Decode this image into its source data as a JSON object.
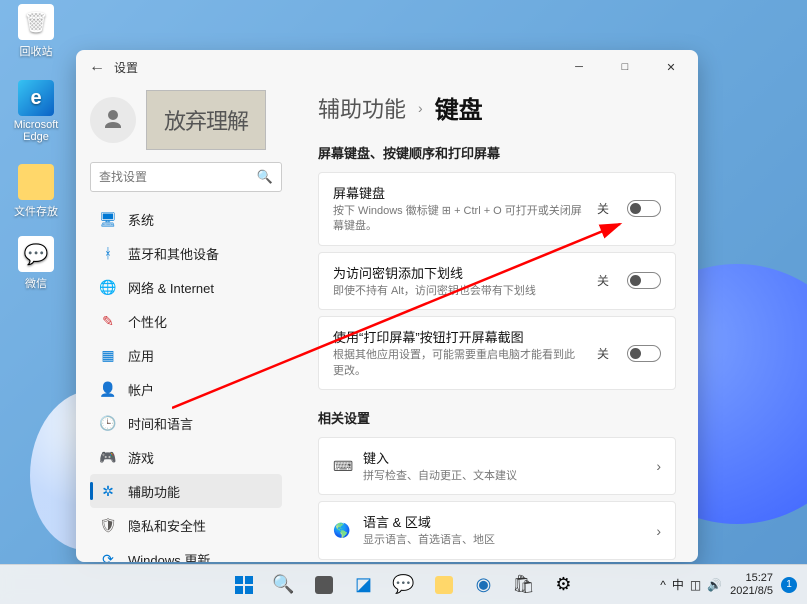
{
  "desktop": {
    "icons": [
      {
        "label": "回收站",
        "glyph_bg": "#ffffff",
        "glyph": "🗑"
      },
      {
        "label": "Microsoft Edge",
        "glyph_bg": "#1b6fb8",
        "glyph": "e"
      },
      {
        "label": "文件存放",
        "glyph_bg": "#ffd76a",
        "glyph": ""
      },
      {
        "label": "微信",
        "glyph_bg": "#1aad19",
        "glyph": "💬"
      }
    ]
  },
  "window": {
    "back": "←",
    "title": "设置",
    "user_caption": "放弃理解",
    "search_placeholder": "查找设置",
    "nav": [
      {
        "icon": "🖥",
        "color": "#0078d4",
        "label": "系统"
      },
      {
        "icon": "ᚼ",
        "color": "#0078d4",
        "label": "蓝牙和其他设备"
      },
      {
        "icon": "🌐",
        "color": "#107c10",
        "label": "网络 & Internet"
      },
      {
        "icon": "✎",
        "color": "#d13438",
        "label": "个性化"
      },
      {
        "icon": "▦",
        "color": "#0078d4",
        "label": "应用"
      },
      {
        "icon": "👤",
        "color": "#8661c5",
        "label": "帐户"
      },
      {
        "icon": "🕒",
        "color": "#c19c00",
        "label": "时间和语言"
      },
      {
        "icon": "🎮",
        "color": "#107c10",
        "label": "游戏"
      },
      {
        "icon": "✲",
        "color": "#0078d4",
        "label": "辅助功能",
        "active": true
      },
      {
        "icon": "🛡",
        "color": "#5d5a58",
        "label": "隐私和安全性"
      },
      {
        "icon": "⟳",
        "color": "#0078d4",
        "label": "Windows 更新"
      }
    ],
    "breadcrumb": {
      "parent": "辅助功能",
      "sep": "›",
      "current": "键盘"
    },
    "section1": "屏幕键盘、按键顺序和打印屏幕",
    "toggles": [
      {
        "title": "屏幕键盘",
        "desc": "按下 Windows 徽标键 ⊞ + Ctrl + O 可打开或关闭屏幕键盘。",
        "state": "关"
      },
      {
        "title": "为访问密钥添加下划线",
        "desc": "即使不持有 Alt，访问密钥也会带有下划线",
        "state": "关"
      },
      {
        "title": "使用“打印屏幕”按钮打开屏幕截图",
        "desc": "根据其他应用设置，可能需要重启电脑才能看到此更改。",
        "state": "关"
      }
    ],
    "section2": "相关设置",
    "links": [
      {
        "icon": "⌨",
        "title": "键入",
        "desc": "拼写检查、自动更正、文本建议"
      },
      {
        "icon": "🌎",
        "title": "语言 & 区域",
        "desc": "显示语言、首选语言、地区"
      }
    ]
  },
  "taskbar": {
    "tray": {
      "chevron": "^",
      "ime": "中",
      "net": "◫",
      "vol": "🔊"
    },
    "time": "15:27",
    "date": "2021/8/5",
    "badge": "1"
  }
}
